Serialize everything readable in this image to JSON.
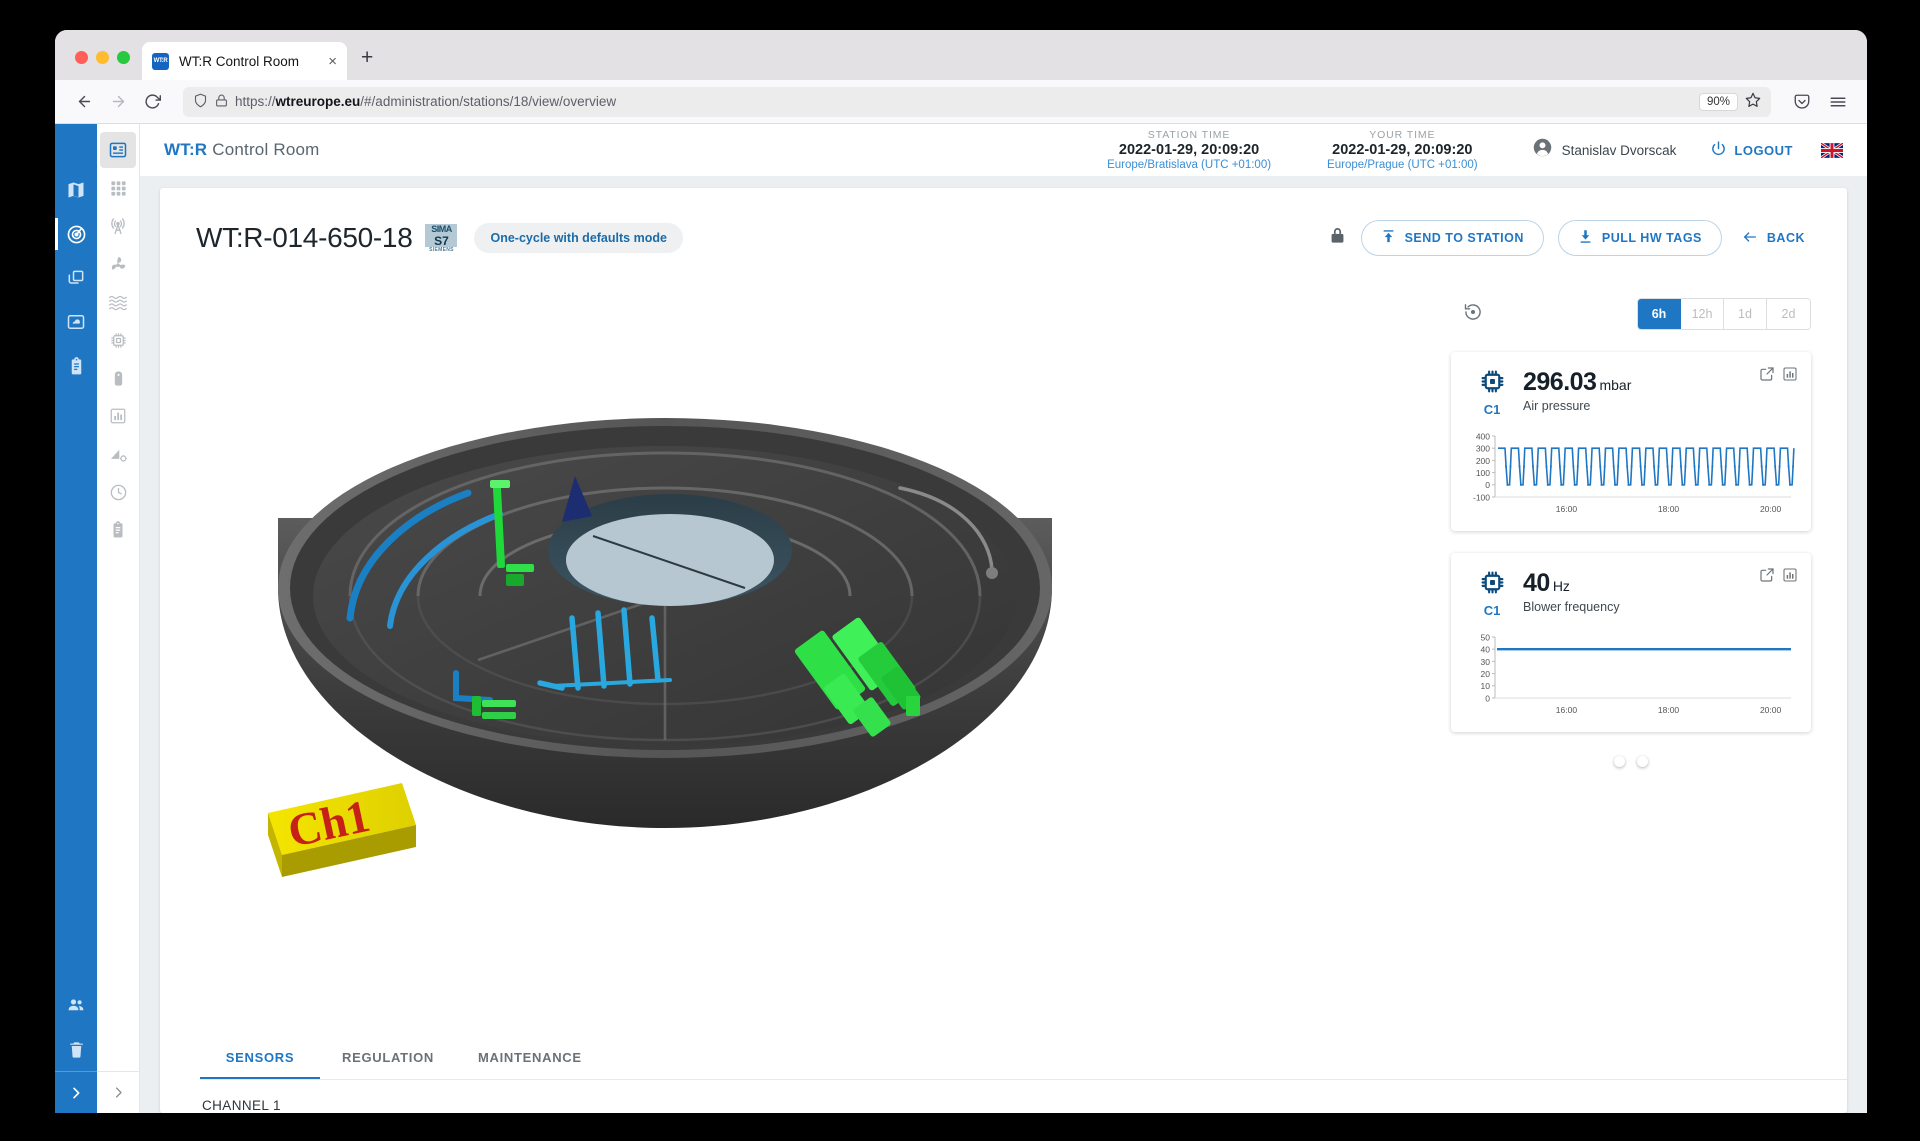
{
  "browser": {
    "tab_title": "WT:R Control Room",
    "tab_favicon_text": "WT:R",
    "new_tab_label": "+",
    "close_label": "×",
    "url_scheme": "https://",
    "url_host": "wtreurope.eu",
    "url_path": "/#/administration/stations/18/view/overview",
    "zoom_level": "90%"
  },
  "header": {
    "brand_bold": "WT:R",
    "brand_rest": "Control Room",
    "station_time": {
      "label": "STATION TIME",
      "value": "2022-01-29, 20:09:20",
      "timezone": "Europe/Bratislava (UTC +01:00)"
    },
    "your_time": {
      "label": "YOUR TIME",
      "value": "2022-01-29, 20:09:20",
      "timezone": "Europe/Prague (UTC +01:00)"
    },
    "user_name": "Stanislav Dvorscak",
    "logout_label": "LOGOUT",
    "language_flag": "uk-flag"
  },
  "page": {
    "title": "WT:R-014-650-18",
    "plc_logo": {
      "line1": "SIMA",
      "line2": "S7",
      "line3": "SIEMENS"
    },
    "mode_badge": "One-cycle with defaults mode",
    "actions": {
      "send_to_station": "SEND TO STATION",
      "pull_hw_tags": "PULL HW TAGS",
      "back": "BACK"
    }
  },
  "viewer": {
    "model_label": "Ch1"
  },
  "time_range": {
    "options": [
      "6h",
      "12h",
      "1d",
      "2d"
    ],
    "selected": "6h"
  },
  "sensor_cards": [
    {
      "channel": "C1",
      "value": "296.03",
      "unit": "mbar",
      "name": "Air pressure"
    },
    {
      "channel": "C1",
      "value": "40",
      "unit": "Hz",
      "name": "Blower frequency"
    }
  ],
  "carousel": {
    "dots": 2,
    "active": 0
  },
  "bottom_tabs": {
    "tabs": [
      "SENSORS",
      "REGULATION",
      "MAINTENANCE"
    ],
    "selected": "SENSORS",
    "channel_heading": "CHANNEL 1"
  },
  "sidebar_primary": [
    {
      "name": "map",
      "active": false
    },
    {
      "name": "stations-radar",
      "active": true
    },
    {
      "name": "layers",
      "active": false
    },
    {
      "name": "cloud",
      "active": false
    },
    {
      "name": "clipboard",
      "active": false
    }
  ],
  "sidebar_primary_bottom": [
    {
      "name": "users",
      "active": false
    },
    {
      "name": "trash",
      "active": false
    }
  ],
  "sidebar_secondary": [
    {
      "name": "chip-overview",
      "active": true
    },
    {
      "name": "grid",
      "active": false
    },
    {
      "name": "antenna",
      "active": false
    },
    {
      "name": "fan",
      "active": false
    },
    {
      "name": "waves",
      "active": false
    },
    {
      "name": "processor",
      "active": false
    },
    {
      "name": "valve",
      "active": false
    },
    {
      "name": "bar-chart",
      "active": false
    },
    {
      "name": "sensor-config",
      "active": false
    },
    {
      "name": "clock",
      "active": false
    },
    {
      "name": "log-clipboard",
      "active": false
    }
  ],
  "chart_data": [
    {
      "type": "line",
      "title": "Air pressure",
      "unit": "mbar",
      "ylabel": "",
      "xlabel": "",
      "ytick_labels": [
        "400",
        "300",
        "200",
        "100",
        "0",
        "-100"
      ],
      "yticks": [
        400,
        300,
        200,
        100,
        0,
        -100
      ],
      "ylim": [
        -100,
        400
      ],
      "xtick_labels": [
        "16:00",
        "18:00",
        "20:00"
      ],
      "xticks": [
        16,
        18,
        20
      ],
      "xlim": [
        14.6,
        20.4
      ],
      "grid": false,
      "series_color": "#1f77c4",
      "series": [
        {
          "name": "Air pressure",
          "pattern": "square-wave",
          "cycles": 22,
          "high": 300,
          "low": 0,
          "mid": 150,
          "values": [
            300,
            300,
            150,
            0,
            0,
            150,
            300,
            300,
            300,
            150,
            0,
            0,
            150,
            300,
            300,
            300,
            150,
            0,
            0,
            150,
            300,
            300
          ]
        }
      ]
    },
    {
      "type": "line",
      "title": "Blower frequency",
      "unit": "Hz",
      "ylabel": "",
      "xlabel": "",
      "ytick_labels": [
        "50",
        "40",
        "30",
        "20",
        "10",
        "0"
      ],
      "yticks": [
        50,
        40,
        30,
        20,
        10,
        0
      ],
      "ylim": [
        0,
        50
      ],
      "xtick_labels": [
        "16:00",
        "18:00",
        "20:00"
      ],
      "xticks": [
        16,
        18,
        20
      ],
      "xlim": [
        14.6,
        20.4
      ],
      "grid": false,
      "series_color": "#1f77c4",
      "series": [
        {
          "name": "Blower frequency",
          "pattern": "constant",
          "values": [
            40,
            40,
            40,
            40,
            40,
            40,
            40,
            40,
            40,
            40
          ]
        }
      ]
    }
  ],
  "colors": {
    "accent": "#1f77c4",
    "rail": "#1f77c4",
    "page_bg": "#eceff1",
    "text": "#1e262c",
    "muted": "#6b7277"
  }
}
